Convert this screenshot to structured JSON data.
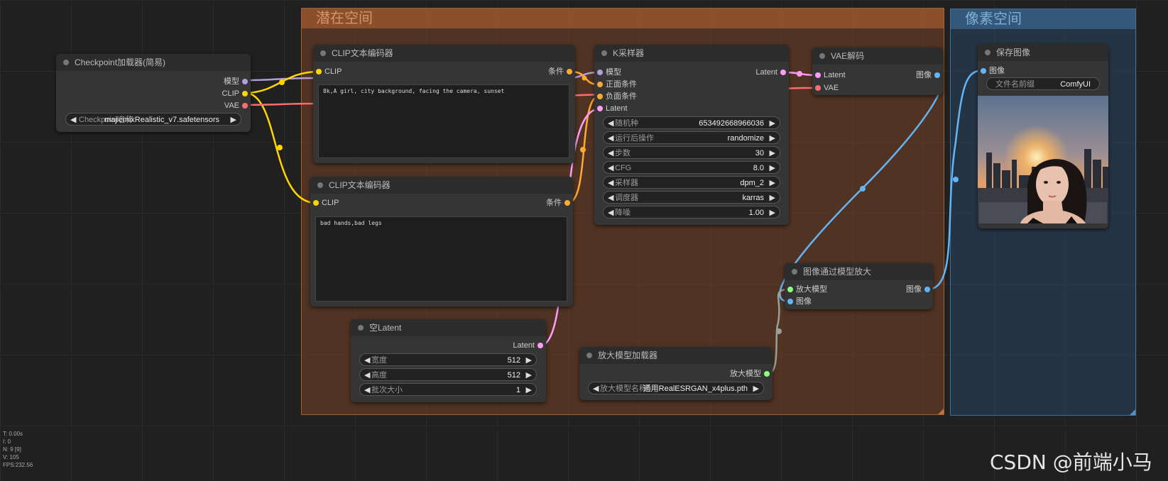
{
  "groups": {
    "latent_title": "潜在空间",
    "pixel_title": "像素空间"
  },
  "checkpoint": {
    "title": "Checkpoint加载器(简易)",
    "out_model": "模型",
    "out_clip": "CLIP",
    "out_vae": "VAE",
    "ckpt_label": "Checkpoint名称",
    "ckpt_value": "majicmixRealistic_v7.safetensors"
  },
  "clip_pos": {
    "title": "CLIP文本编码器",
    "in_clip": "CLIP",
    "out_cond": "条件",
    "text": "8k,A girl, city background, facing the camera, sunset"
  },
  "clip_neg": {
    "title": "CLIP文本编码器",
    "in_clip": "CLIP",
    "out_cond": "条件",
    "text": "bad hands,bad legs"
  },
  "ksampler": {
    "title": "K采样器",
    "in_model": "模型",
    "in_pos": "正面条件",
    "in_neg": "负面条件",
    "in_latent": "Latent",
    "out_latent": "Latent",
    "widgets": [
      {
        "label": "随机种",
        "value": "653492668966036"
      },
      {
        "label": "运行后操作",
        "value": "randomize"
      },
      {
        "label": "步数",
        "value": "30"
      },
      {
        "label": "CFG",
        "value": "8.0"
      },
      {
        "label": "采样器",
        "value": "dpm_2"
      },
      {
        "label": "调度器",
        "value": "karras"
      },
      {
        "label": "降噪",
        "value": "1.00"
      }
    ]
  },
  "empty_latent": {
    "title": "空Latent",
    "out_latent": "Latent",
    "widgets": [
      {
        "label": "宽度",
        "value": "512"
      },
      {
        "label": "高度",
        "value": "512"
      },
      {
        "label": "批次大小",
        "value": "1"
      }
    ]
  },
  "vae_decode": {
    "title": "VAE解码",
    "in_latent": "Latent",
    "in_vae": "VAE",
    "out_image": "图像"
  },
  "upscale_loader": {
    "title": "放大模型加载器",
    "out_model": "放大模型",
    "w_label": "放大模型名称",
    "w_value": "通用RealESRGAN_x4plus.pth"
  },
  "upscale": {
    "title": "图像通过模型放大",
    "in_model": "放大模型",
    "in_image": "图像",
    "out_image": "图像"
  },
  "save": {
    "title": "保存图像",
    "in_image": "图像",
    "prefix_label": "文件名前缀",
    "prefix_value": "ComfyUI"
  },
  "stats": {
    "t": "T: 0.00s",
    "i": "I: 0",
    "n": "N: 9 [9]",
    "v": "V: 105",
    "fps": "FPS:232.56"
  },
  "watermark": "CSDN @前端小马",
  "colors": {
    "model": "#b39ddb",
    "clip": "#ffd500",
    "vae": "#ff6e6e",
    "conditioning": "#ffa931",
    "latent": "#ff9cf9",
    "image": "#64b5f6",
    "upscale_model": "#8fff80"
  }
}
